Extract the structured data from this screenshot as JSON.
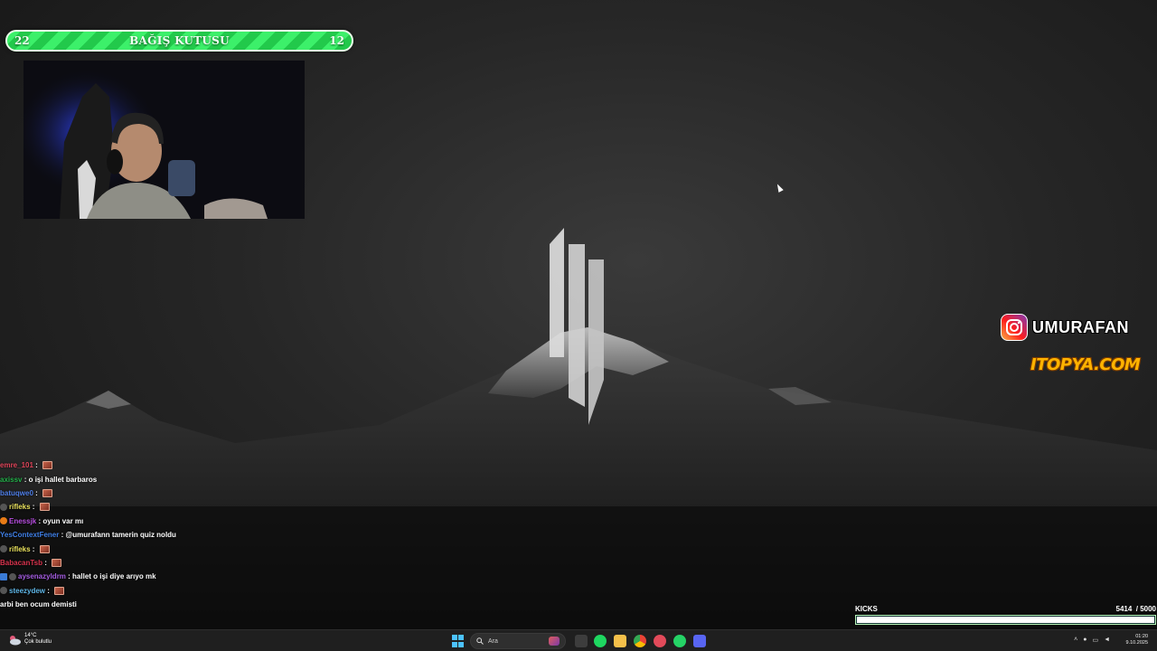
{
  "donation": {
    "left_value": "22",
    "title": "BAĞIŞ KUTUSU",
    "right_value": "12"
  },
  "social": {
    "instagram_handle": "UMURAFAN",
    "sponsor_text": "ITOPYA.COM"
  },
  "chat": [
    {
      "user": "emre_101",
      "color": "#e0455a",
      "badge": "",
      "message": "",
      "emote": true
    },
    {
      "user": "axissv",
      "color": "#23b04a",
      "badge": "",
      "message": "o işi hallet barbaros",
      "emote": false
    },
    {
      "user": "batuqwe0",
      "color": "#4f7fe8",
      "badge": "",
      "message": "",
      "emote": true
    },
    {
      "user": "rifleks",
      "color": "#e8e05c",
      "badge": "ai",
      "message": "",
      "emote": true
    },
    {
      "user": "Enessjk",
      "color": "#b84ee0",
      "badge": "orange",
      "message": "oyun var mı",
      "emote": false
    },
    {
      "user": "YesContextFener",
      "color": "#3f7fe6",
      "badge": "",
      "message": "@umurafann tamerin quiz noldu",
      "emote": false
    },
    {
      "user": "rifleks",
      "color": "#e8e05c",
      "badge": "ai",
      "message": "",
      "emote": true
    },
    {
      "user": "BabacanTsb",
      "color": "#d8334d",
      "badge": "",
      "message": "",
      "emote": true
    },
    {
      "user": "aysenazyldrm",
      "color": "#a35ce0",
      "badge": "blue-ai",
      "message": "hallet o işi diye arıyo mk",
      "emote": false
    },
    {
      "user": "steezydew",
      "color": "#5fb6e6",
      "badge": "ai",
      "message": "",
      "emote": true
    },
    {
      "user": "",
      "color": "#ffffff",
      "badge": "",
      "message": "arbi ben ocum demisti",
      "emote": false
    }
  ],
  "kicks": {
    "label": "KICKS",
    "current": "5414",
    "goal": "/ 5000",
    "progress": 1.0
  },
  "taskbar": {
    "weather_temp": "14°C",
    "weather_desc": "Çok bulutlu",
    "search_placeholder": "Ara",
    "time": "01:20",
    "date": "9.10.2025"
  },
  "colors": {
    "accent_green": "#2ed85a",
    "windows_blue": "#4cc2ff",
    "instagram": "#e1306c"
  }
}
